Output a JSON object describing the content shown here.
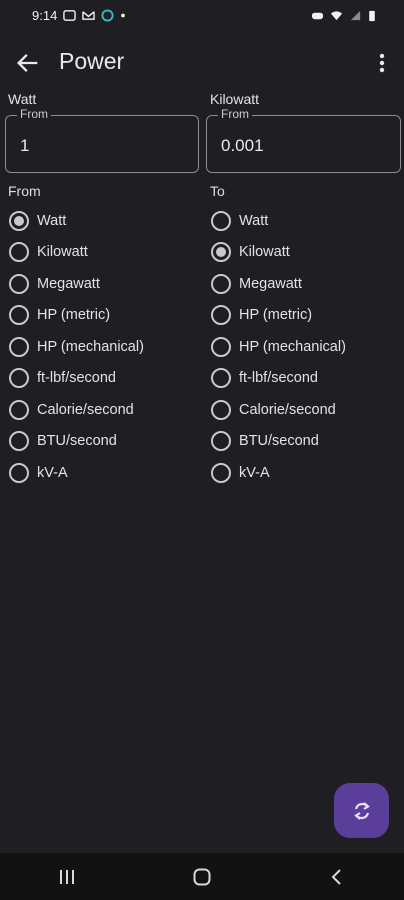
{
  "status": {
    "time": "9:14"
  },
  "appbar": {
    "title": "Power"
  },
  "inputs": {
    "from_unit": "Watt",
    "to_unit": "Kilowatt",
    "from_legend": "From",
    "from_value": "1",
    "to_legend": "From",
    "to_value": "0.001"
  },
  "lists": {
    "from_title": "From",
    "to_title": "To",
    "units": [
      "Watt",
      "Kilowatt",
      "Megawatt",
      "HP (metric)",
      "HP (mechanical)",
      "ft-lbf/second",
      "Calorie/second",
      "BTU/second",
      "kV-A"
    ],
    "from_selected": "Watt",
    "to_selected": "Kilowatt"
  },
  "colors": {
    "fab": "#5b3e9a",
    "background": "#1f1e22"
  },
  "icons": {
    "back": "arrow-left-icon",
    "more": "more-vert-icon",
    "fab": "swap-refresh-icon"
  }
}
